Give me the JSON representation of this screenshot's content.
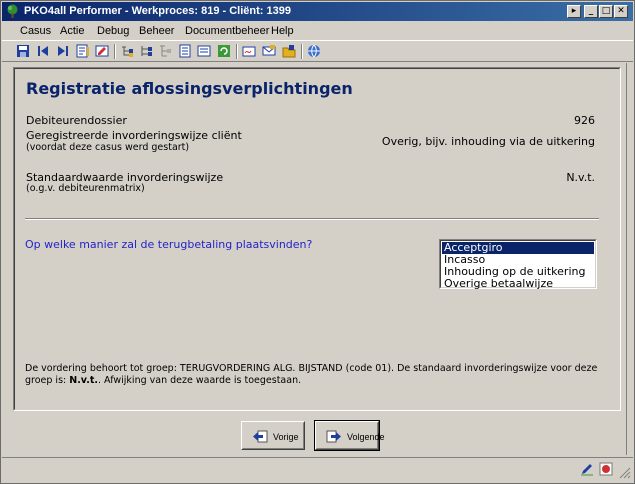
{
  "window": {
    "title": "PKO4all Performer - Werkproces: 819 - Cliënt: 1399",
    "controls": [
      "restore",
      "minimize",
      "maximize",
      "close"
    ]
  },
  "menu": {
    "items": [
      "Casus",
      "Actie",
      "Debug",
      "Beheer",
      "Documentbeheer",
      "Help"
    ]
  },
  "toolbar": {
    "icons": [
      "save-icon",
      "first-record-icon",
      "last-record-icon",
      "notes-icon",
      "edit-form-icon",
      "tree-icon",
      "hierarchy-icon",
      "document-icon",
      "list-icon",
      "refresh-icon",
      "signature-icon",
      "mail-icon",
      "folder-icon",
      "globe-icon"
    ]
  },
  "page": {
    "heading": "Registratie aflossingsverplichtingen",
    "debiteurendossier_label": "Debiteurendossier",
    "debiteurendossier_value": "926",
    "geregistreerde_label": "Geregistreerde invorderingswijze cliënt",
    "geregistreerde_sub": "(voordat deze casus werd gestart)",
    "geregistreerde_value": "Overig, bijv. inhouding via de uitkering",
    "standaard_label": "Standaardwaarde invorderingswijze",
    "standaard_sub": "(o.g.v. debiteurenmatrix)",
    "standaard_value": "N.v.t.",
    "question": "Op welke manier zal de terugbetaling plaatsvinden?",
    "options": [
      "Acceptgiro",
      "Incasso",
      "Inhouding op de uitkering",
      "Overige betaalwijze"
    ],
    "selected_option": "Acceptgiro",
    "note_part1": "De vordering behoort tot groep: TERUGVORDERING ALG. BIJSTAND (code 01). De standaard invorderingswijze voor deze groep is: ",
    "note_bold": "N.v.t.",
    "note_part2": ". Afwijking van deze waarde is toegestaan."
  },
  "buttons": {
    "prev_label": "Vorige",
    "next_label": "Volgende"
  },
  "colors": {
    "titlebar_start": "#0a246a",
    "titlebar_end": "#3a6ea5",
    "heading": "#0a246a",
    "question": "#2323c8",
    "selection": "#0a246a",
    "face": "#d4d0c8"
  }
}
